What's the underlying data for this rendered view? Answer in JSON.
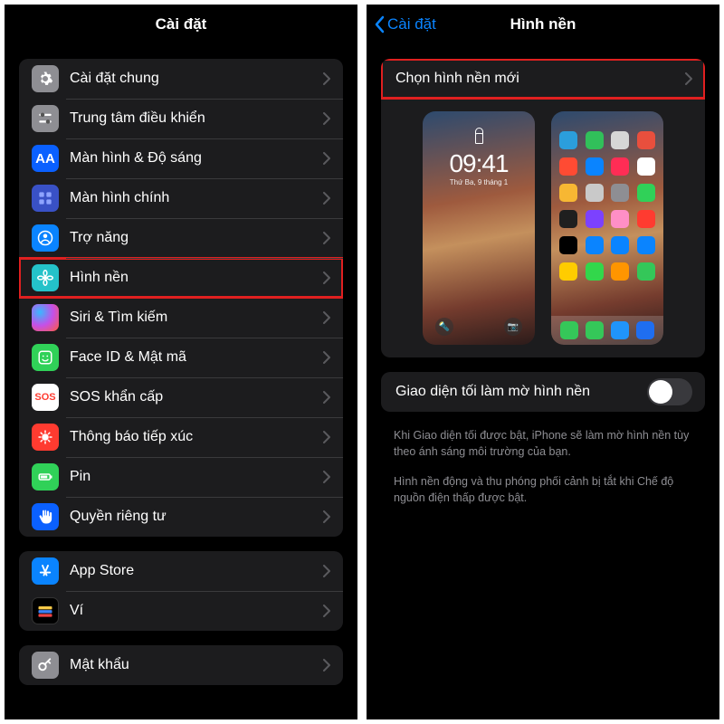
{
  "left": {
    "title": "Cài đặt",
    "groups": [
      {
        "items": [
          {
            "key": "general",
            "label": "Cài đặt chung",
            "iconClass": "ic-general",
            "svg": "gear"
          },
          {
            "key": "control-center",
            "label": "Trung tâm điều khiển",
            "iconClass": "ic-control",
            "svg": "sliders"
          },
          {
            "key": "display",
            "label": "Màn hình & Độ sáng",
            "iconClass": "ic-display",
            "text": "AA"
          },
          {
            "key": "home-screen",
            "label": "Màn hình chính",
            "iconClass": "ic-home",
            "svg": "grid"
          },
          {
            "key": "accessibility",
            "label": "Trợ năng",
            "iconClass": "ic-access",
            "svg": "person"
          },
          {
            "key": "wallpaper",
            "label": "Hình nền",
            "iconClass": "ic-wall",
            "svg": "flower",
            "highlight": true
          },
          {
            "key": "siri",
            "label": "Siri & Tìm kiếm",
            "iconClass": "ic-siri"
          },
          {
            "key": "faceid",
            "label": "Face ID & Mật mã",
            "iconClass": "ic-face",
            "svg": "face"
          },
          {
            "key": "sos",
            "label": "SOS khẩn cấp",
            "iconClass": "ic-sos",
            "text": "SOS"
          },
          {
            "key": "exposure",
            "label": "Thông báo tiếp xúc",
            "iconClass": "ic-expose",
            "svg": "virus"
          },
          {
            "key": "battery",
            "label": "Pin",
            "iconClass": "ic-battery",
            "svg": "battery"
          },
          {
            "key": "privacy",
            "label": "Quyền riêng tư",
            "iconClass": "ic-privacy",
            "svg": "hand"
          }
        ]
      },
      {
        "items": [
          {
            "key": "appstore",
            "label": "App Store",
            "iconClass": "ic-store",
            "svg": "store"
          },
          {
            "key": "wallet",
            "label": "Ví",
            "iconClass": "ic-wallet",
            "svg": "wallet"
          }
        ]
      },
      {
        "items": [
          {
            "key": "passwords",
            "label": "Mật khẩu",
            "iconClass": "ic-pass",
            "svg": "key"
          }
        ]
      }
    ]
  },
  "right": {
    "back": "Cài đặt",
    "title": "Hình nền",
    "choose_label": "Chọn hình nền mới",
    "dim_label": "Giao diện tối làm mờ hình nền",
    "dim_on": false,
    "footer1": "Khi Giao diện tối được bật, iPhone sẽ làm mờ hình nền tùy theo ánh sáng môi trường của bạn.",
    "footer2": "Hình nền động và thu phóng phối cảnh bị tắt khi Chế độ nguồn điện thấp được bật.",
    "lock_time": "09:41",
    "lock_date": "Thứ Ba, 9 tháng 1",
    "dock_colors": [
      "#35c759",
      "#35c759",
      "#2094fa",
      "#1f6ef0"
    ],
    "home_apps": [
      "#2b9edc",
      "#31c05a",
      "#d6d6d6",
      "#e84f3d",
      "#ff4b33",
      "#0a84ff",
      "#ff2d55",
      "#ffffff",
      "#f7b733",
      "#c9c9c9",
      "#8e8e93",
      "#30d158",
      "#1f1f1f",
      "#7c41ff",
      "#ff8fc6",
      "#ff3b30",
      "#000",
      "#0a84ff",
      "#0a84ff",
      "#0a84ff",
      "#ffcc00",
      "#32d74b",
      "#ff9500",
      "#34c759"
    ]
  }
}
